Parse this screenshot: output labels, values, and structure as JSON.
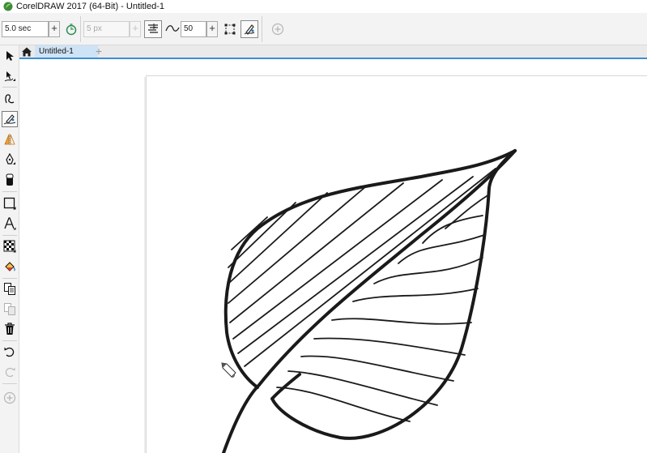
{
  "window": {
    "title": "CorelDRAW 2017 (64-Bit) - Untitled-1"
  },
  "property_bar": {
    "timer_value": "5.0 sec",
    "width_value": "5 px",
    "smoothing_value": "50"
  },
  "tabs": {
    "document_tab": "Untitled-1",
    "add_tab_symbol": "+"
  },
  "icons": [
    "coreldraw-logo-icon",
    "plus-icon",
    "stopwatch-icon",
    "flatten-icon",
    "smoothing-icon",
    "bounding-box-icon",
    "artistic-media-icon",
    "add-icon",
    "home-icon",
    "pick-tool-icon",
    "shape-tool-icon",
    "freehand-tool-icon",
    "pen-tool-icon",
    "eraser-tool-icon",
    "rectangle-tool-icon",
    "text-tool-icon",
    "transparency-tool-icon",
    "fill-tool-icon",
    "copy-properties-icon",
    "paste-icon",
    "delete-icon",
    "undo-icon",
    "redo-icon",
    "pencil-cursor-icon"
  ],
  "colors": {
    "accent": "#3c8fd6",
    "tab_active": "#cfe3f6",
    "canvas": "#ffffff",
    "ink": "#1a1a1a"
  }
}
